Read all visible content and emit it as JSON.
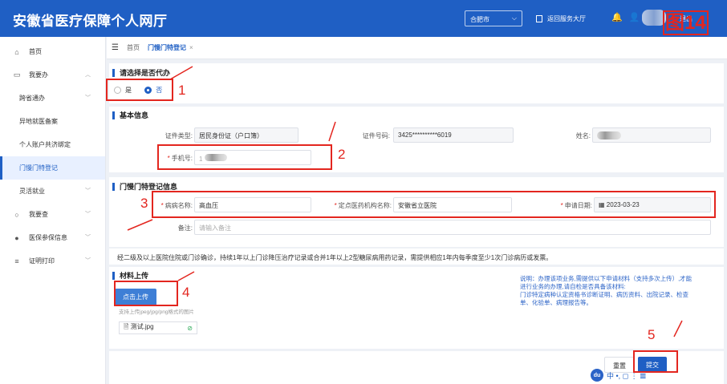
{
  "header": {
    "title": "安徽省医疗保障个人网厅",
    "city": "合肥市",
    "return_label": "返回服务大厅",
    "logout_label": "退出",
    "figure_label": "图14"
  },
  "sidebar": {
    "items": [
      {
        "label": "首页",
        "icon": "home-icon"
      },
      {
        "label": "我要办",
        "icon": "folder-icon"
      },
      {
        "label": "跨省通办",
        "icon": ""
      },
      {
        "label": "异地就医备案",
        "icon": ""
      },
      {
        "label": "个人账户共济绑定",
        "icon": ""
      },
      {
        "label": "门慢门特登记",
        "icon": ""
      },
      {
        "label": "灵活就业",
        "icon": ""
      },
      {
        "label": "我要查",
        "icon": "search-icon"
      },
      {
        "label": "医保参保信息",
        "icon": "user-icon"
      },
      {
        "label": "证明打印",
        "icon": "list-icon"
      }
    ]
  },
  "breadcrumb": {
    "home": "首页",
    "tab": "门慢门特登记",
    "close": "×"
  },
  "proxy": {
    "title": "请选择是否代办",
    "yes": "是",
    "no": "否",
    "selected": "否"
  },
  "basic": {
    "title": "基本信息",
    "id_type_label": "证件类型:",
    "id_type_value": "居民身份证（户口簿）",
    "id_no_label": "证件号码:",
    "id_no_value": "3425**********6019",
    "name_label": "姓名:",
    "phone_label": "手机号:",
    "phone_prefix": "1"
  },
  "registration": {
    "title": "门慢门特登记信息",
    "disease_label": "病病名称:",
    "disease_value": "高血压",
    "hospital_label": "定点医药机构名称:",
    "hospital_value": "安徽省立医院",
    "date_label": "申请日期:",
    "date_value": "2023-03-23",
    "remark_label": "备注:",
    "remark_placeholder": "请输入备注"
  },
  "notice": "经二级及以上医院住院或门诊确诊，持续1年以上门诊降压治疗记录或合并1年以上2型糖尿病用药记录，需提供相应1年内每季度至少1次门诊病历或发票。",
  "upload": {
    "title": "材料上传",
    "button": "点击上传",
    "hint": "支持上传jpeg/jpg/png格式的图片",
    "file": "测试.jpg",
    "explain_lines": [
      "说明：办理该项业务,需提供以下申请材料（支持多次上传）,才能",
      "进行业务的办理,请自检是否具备该材料:",
      "门诊特定病种认定资格书诊断证明、病历资料、出院记录、检查",
      "单、化验单、病理报告等。"
    ]
  },
  "actions": {
    "reset": "重置",
    "submit": "提交"
  },
  "annotations": [
    "1",
    "2",
    "3",
    "4",
    "5"
  ],
  "floating_tool": {
    "logo": "du",
    "text": "中 •, ◻ ⋮ 𝌆"
  },
  "colors": {
    "primary": "#1f5fc4",
    "annotation_red": "#e3261f",
    "explain_text": "#2b63c7"
  }
}
